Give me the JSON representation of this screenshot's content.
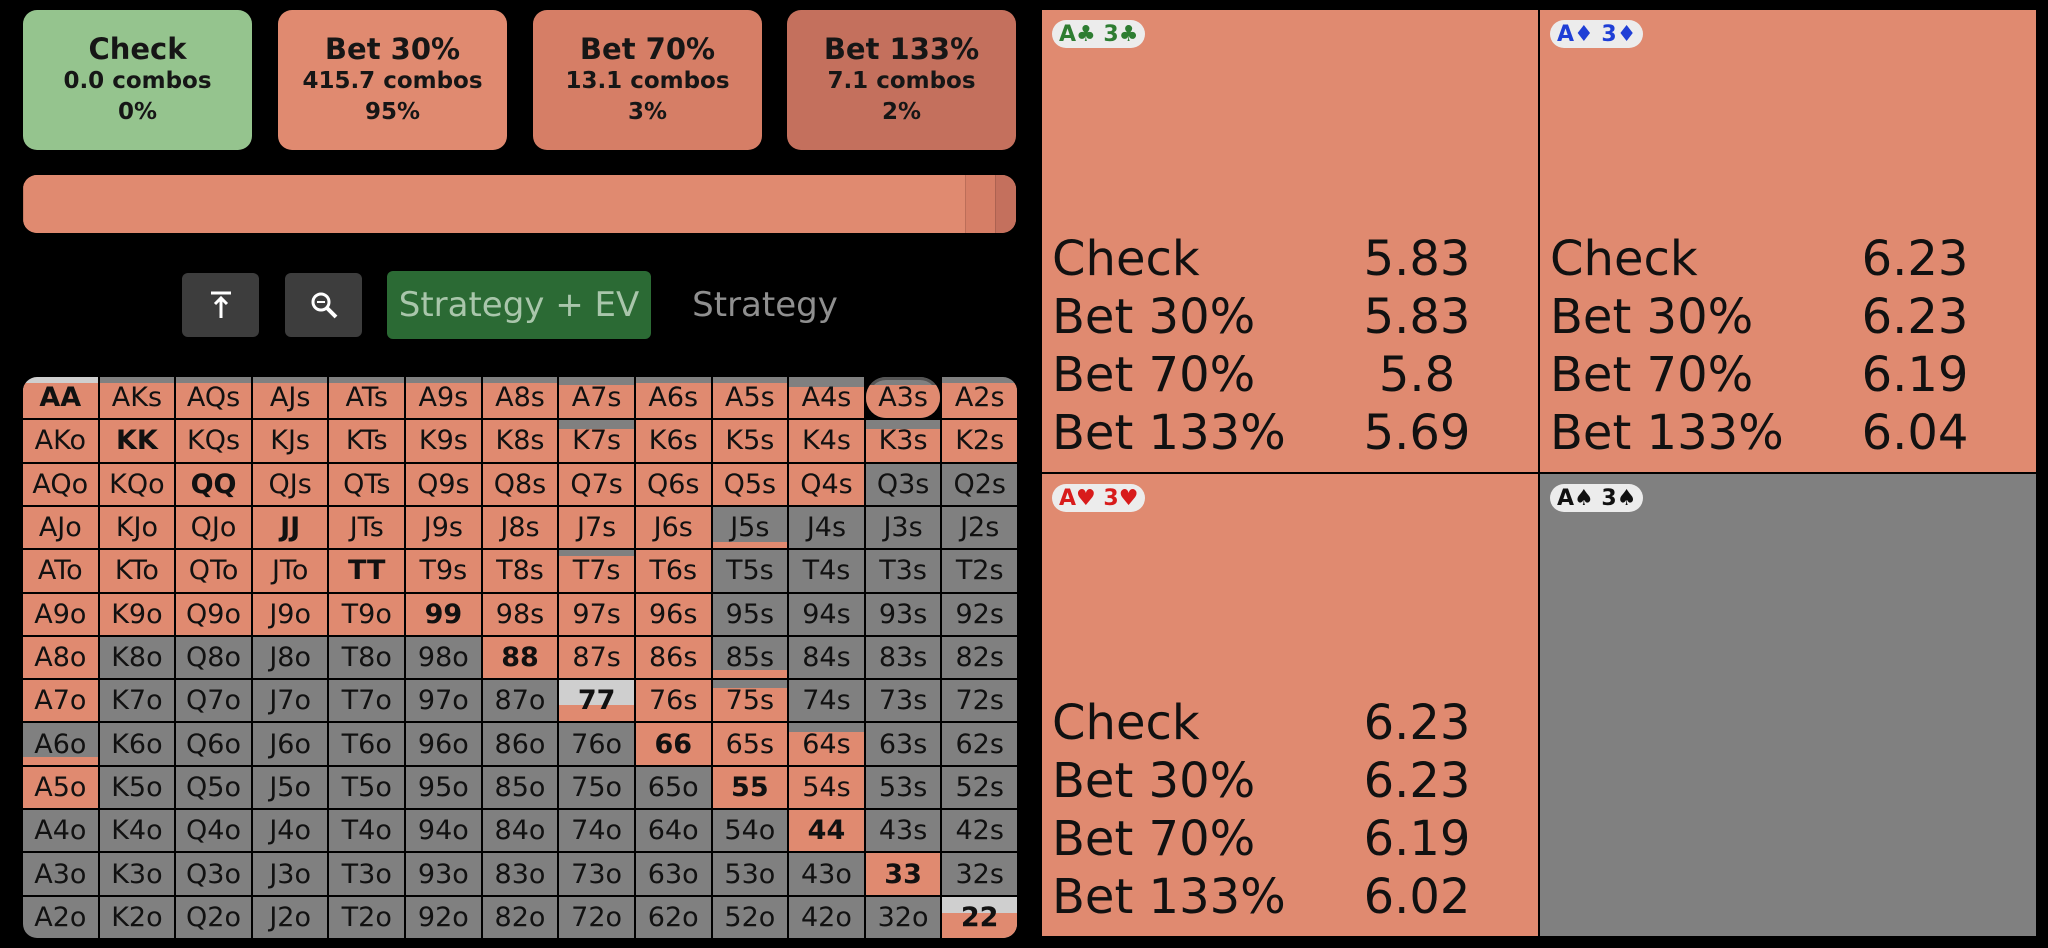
{
  "colors": {
    "check": "#95c48e",
    "bet30": "#e08a70",
    "bet70": "#d67e66",
    "bet133": "#c4705d",
    "empty": "#808080"
  },
  "actions": [
    {
      "name": "Check",
      "combos": "0.0 combos",
      "pct": "0%",
      "color": "#95c48e"
    },
    {
      "name": "Bet 30%",
      "combos": "415.7 combos",
      "pct": "95%",
      "color": "#e08a70"
    },
    {
      "name": "Bet 70%",
      "combos": "13.1 combos",
      "pct": "3%",
      "color": "#d67e66"
    },
    {
      "name": "Bet 133%",
      "combos": "7.1 combos",
      "pct": "2%",
      "color": "#c4705d"
    }
  ],
  "strategy_bar": [
    {
      "label": "Check",
      "fraction": 0.0,
      "color": "#95c48e"
    },
    {
      "label": "Bet 30%",
      "fraction": 0.95,
      "color": "#e08a70"
    },
    {
      "label": "Bet 70%",
      "fraction": 0.03,
      "color": "#d67e66"
    },
    {
      "label": "Bet 133%",
      "fraction": 0.02,
      "color": "#c4705d"
    }
  ],
  "toolbar": {
    "icons": [
      "collapse-up-icon",
      "zoom-search-icon"
    ],
    "mode_active": "Strategy + EV",
    "mode_inactive": "Strategy"
  },
  "grid": {
    "ranks": [
      "A",
      "K",
      "Q",
      "J",
      "T",
      "9",
      "8",
      "7",
      "6",
      "5",
      "4",
      "3",
      "2"
    ],
    "selected": "A3s",
    "bet_fraction": [
      [
        0.85,
        0.85,
        0.85,
        0.85,
        0.85,
        0.85,
        0.85,
        0.8,
        0.85,
        0.85,
        0.75,
        0.8,
        0.85
      ],
      [
        1,
        1,
        1,
        1,
        1,
        1,
        1,
        0.8,
        1,
        1,
        1,
        0.8,
        1
      ],
      [
        1,
        1,
        1,
        1,
        1,
        1,
        1,
        1,
        1,
        1,
        1,
        0,
        0
      ],
      [
        1,
        1,
        1,
        1,
        1,
        1,
        1,
        1,
        1,
        0.15,
        0,
        0,
        0
      ],
      [
        1,
        1,
        1,
        1,
        1,
        1,
        1,
        0.85,
        1,
        0,
        0,
        0,
        0
      ],
      [
        1,
        1,
        1,
        1,
        1,
        1,
        1,
        1,
        1,
        0,
        0,
        0,
        0
      ],
      [
        1,
        0,
        0,
        0,
        0,
        0,
        1,
        1,
        1,
        0.2,
        0,
        0,
        0
      ],
      [
        1,
        0,
        0,
        0,
        0,
        0,
        0,
        0.4,
        1,
        0.8,
        0,
        0,
        0
      ],
      [
        0.2,
        0,
        0,
        0,
        0,
        0,
        0,
        0,
        1,
        1,
        0.8,
        0,
        0
      ],
      [
        1,
        0,
        0,
        0,
        0,
        0,
        0,
        0,
        0,
        1,
        1,
        0,
        0
      ],
      [
        0,
        0,
        0,
        0,
        0,
        0,
        0,
        0,
        0,
        0,
        1,
        0,
        0
      ],
      [
        0,
        0,
        0,
        0,
        0,
        0,
        0,
        0,
        0,
        0,
        0,
        1,
        0
      ],
      [
        0,
        0,
        0,
        0,
        0,
        0,
        0,
        0,
        0,
        0,
        0,
        0,
        0.6
      ]
    ]
  },
  "combos": [
    {
      "label": "A♣ 3♣",
      "color": "#2e7d32",
      "empty": false,
      "rows": [
        {
          "action": "Check",
          "ev": "5.83"
        },
        {
          "action": "Bet 30%",
          "ev": "5.83"
        },
        {
          "action": "Bet 70%",
          "ev": "5.8"
        },
        {
          "action": "Bet 133%",
          "ev": "5.69"
        }
      ]
    },
    {
      "label": "A♦ 3♦",
      "color": "#1f3fd6",
      "empty": false,
      "rows": [
        {
          "action": "Check",
          "ev": "6.23"
        },
        {
          "action": "Bet 30%",
          "ev": "6.23"
        },
        {
          "action": "Bet 70%",
          "ev": "6.19"
        },
        {
          "action": "Bet 133%",
          "ev": "6.04"
        }
      ]
    },
    {
      "label": "A♥ 3♥",
      "color": "#d81b1b",
      "empty": false,
      "rows": [
        {
          "action": "Check",
          "ev": "6.23"
        },
        {
          "action": "Bet 30%",
          "ev": "6.23"
        },
        {
          "action": "Bet 70%",
          "ev": "6.19"
        },
        {
          "action": "Bet 133%",
          "ev": "6.02"
        }
      ]
    },
    {
      "label": "A♠ 3♠",
      "color": "#111111",
      "empty": true,
      "rows": []
    }
  ]
}
